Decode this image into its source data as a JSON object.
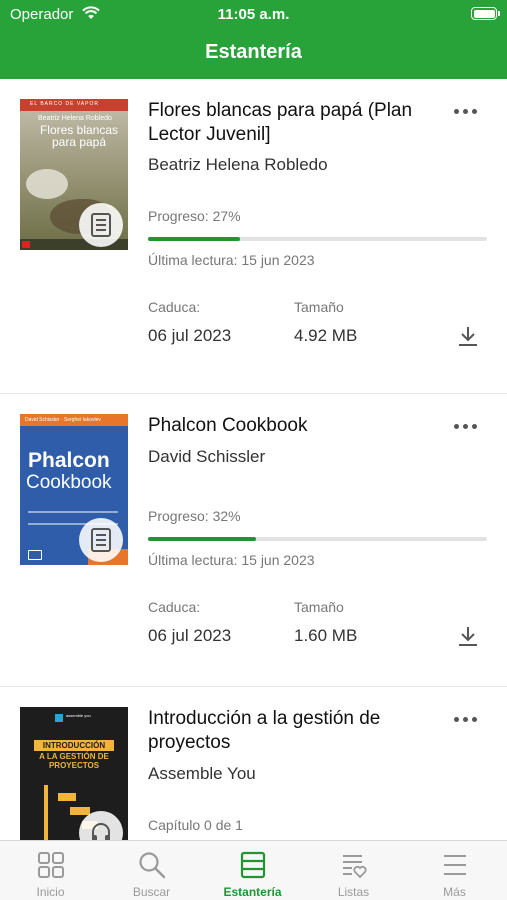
{
  "status_bar": {
    "carrier": "Operador",
    "time": "11:05 a.m."
  },
  "nav": {
    "title": "Estantería"
  },
  "books": [
    {
      "title": "Flores blancas para papá (Plan Lector Juvenil]",
      "author": "Beatriz Helena Robledo",
      "progress_label": "Progreso: 27%",
      "progress": 0.27,
      "last_read": "Última lectura: 15 jun 2023",
      "expires_label": "Caduca:",
      "expires_value": "06 jul 2023",
      "size_label": "Tamaño",
      "size_value": "4.92 MB",
      "format_icon": "document-icon",
      "cover": {
        "series": "EL BARCO DE VAPOR",
        "author": "Beatriz Helena Robledo",
        "title": "Flores blancas para papá"
      }
    },
    {
      "title": "Phalcon Cookbook",
      "author": "David Schissler",
      "progress_label": "Progreso: 32%",
      "progress": 0.32,
      "last_read": "Última lectura: 15 jun 2023",
      "expires_label": "Caduca:",
      "expires_value": "06 jul 2023",
      "size_label": "Tamaño",
      "size_value": "1.60 MB",
      "format_icon": "document-icon",
      "cover": {
        "top_text": "David Schissler · Serghei Iakovlev",
        "title_1": "Phalcon",
        "title_2": "Cookbook"
      }
    },
    {
      "title": "Introducción a la gestión de proyectos",
      "author": "Assemble You",
      "progress_label": "Capítulo 0 de 1",
      "format_icon": "headphones-icon",
      "cover": {
        "logo": "assemble you",
        "title_1": "INTRODUCCIÓN",
        "title_2": "A LA GESTIÓN DE PROYECTOS"
      }
    }
  ],
  "tabs": [
    {
      "label": "Inicio",
      "icon": "grid-icon",
      "active": false
    },
    {
      "label": "Buscar",
      "icon": "search-icon",
      "active": false
    },
    {
      "label": "Estantería",
      "icon": "shelf-icon",
      "active": true
    },
    {
      "label": "Listas",
      "icon": "list-heart-icon",
      "active": false
    },
    {
      "label": "Más",
      "icon": "menu-icon",
      "active": false
    }
  ],
  "colors": {
    "brand_green": "#27a33a",
    "progress_green": "#1f9631",
    "inactive_tab": "#9a9a9a"
  }
}
